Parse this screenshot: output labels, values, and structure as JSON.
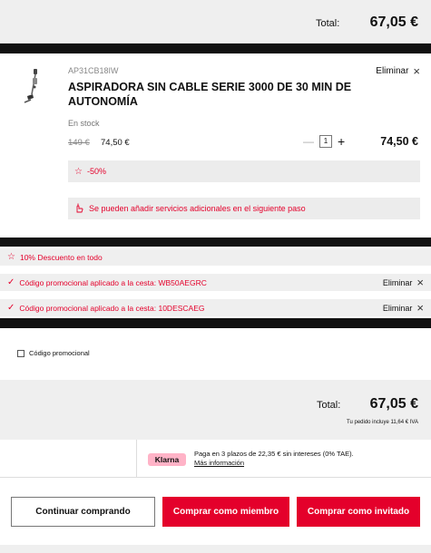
{
  "top_summary": {
    "total_label": "Total:",
    "total_value": "67,05 €"
  },
  "product": {
    "sku": "AP31CB18IW",
    "title": "ASPIRADORA SIN CABLE SERIE 3000 DE 30 MIN DE AUTONOMÍA",
    "stock": "En stock",
    "old_price": "149 €",
    "price": "74,50 €",
    "quantity": "1",
    "line_total": "74,50 €",
    "remove_label": "Eliminar",
    "discount_label": "-50%",
    "services_note": "Se pueden añadir servicios adicionales en el siguiente paso"
  },
  "promotions": [
    {
      "text": "10% Descuento en todo"
    },
    {
      "text": "Código promocional aplicado a la cesta: WB50AEGRC",
      "remove_label": "Eliminar"
    },
    {
      "text": "Código promocional aplicado a la cesta: 10DESCAEG",
      "remove_label": "Eliminar"
    }
  ],
  "promo_code_label": "Código promocional",
  "summary": {
    "total_label": "Total:",
    "total_value": "67,05 €",
    "vat_note": "Tu pedido incluye 11,64 € IVA"
  },
  "klarna": {
    "badge": "Klarna",
    "text": "Paga en 3 plazos de 22,35 € sin intereses (0% TAE).",
    "link": "Más información"
  },
  "buttons": {
    "continue": "Continuar comprando",
    "member": "Comprar como miembro",
    "guest": "Comprar como invitado"
  },
  "colors": {
    "accent": "#e4002b",
    "panel": "#efefef",
    "dark": "#111111"
  }
}
